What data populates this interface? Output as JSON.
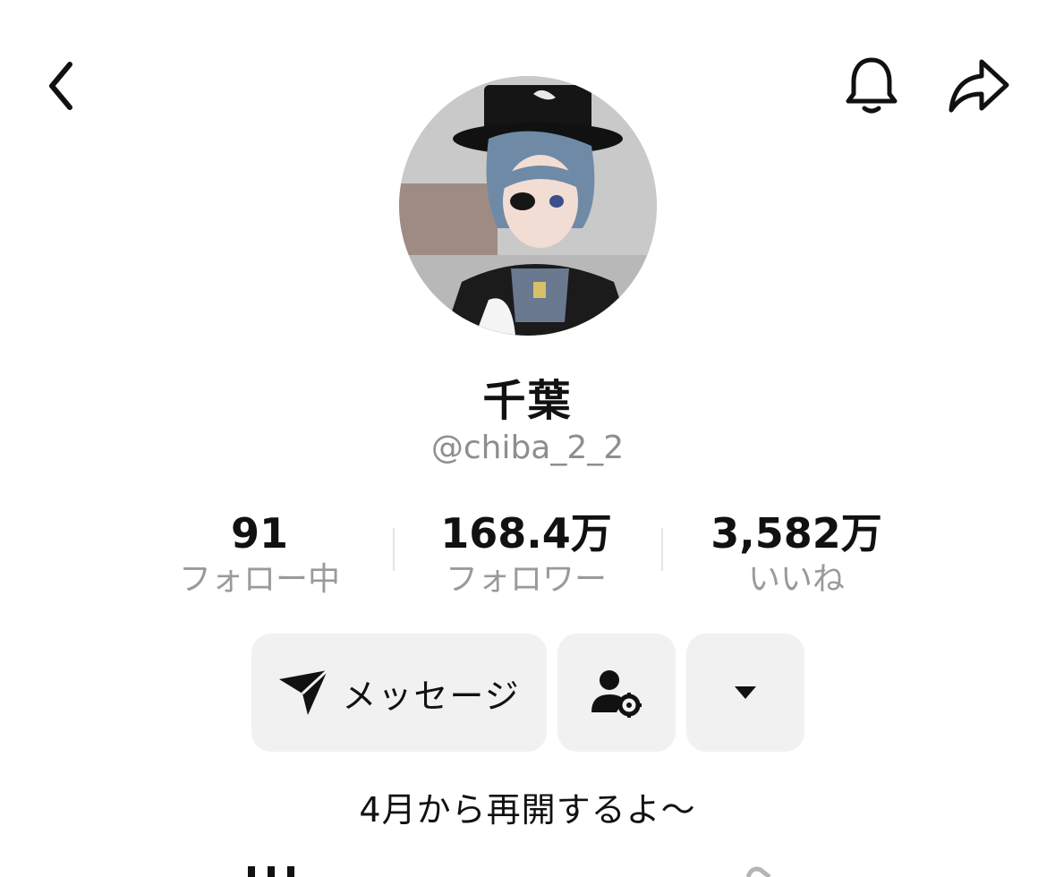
{
  "header": {
    "back_icon": "chevron-left-icon",
    "bell_icon": "bell-icon",
    "share_icon": "share-arrow-icon"
  },
  "profile": {
    "display_name": "千葉",
    "username": "@chiba_2_2"
  },
  "stats": {
    "following": {
      "value": "91",
      "label": "フォロー中"
    },
    "followers": {
      "value": "168.4万",
      "label": "フォロワー"
    },
    "likes": {
      "value": "3,582万",
      "label": "いいね"
    }
  },
  "actions": {
    "message_label": "メッセージ",
    "message_icon": "send-icon",
    "friend_settings_icon": "person-gear-icon",
    "more_icon": "caret-down-icon"
  },
  "bio": "4月から再開するよ〜",
  "colors": {
    "text_primary": "#111111",
    "text_secondary": "#8e8e8e",
    "button_bg": "#f1f1f1"
  }
}
